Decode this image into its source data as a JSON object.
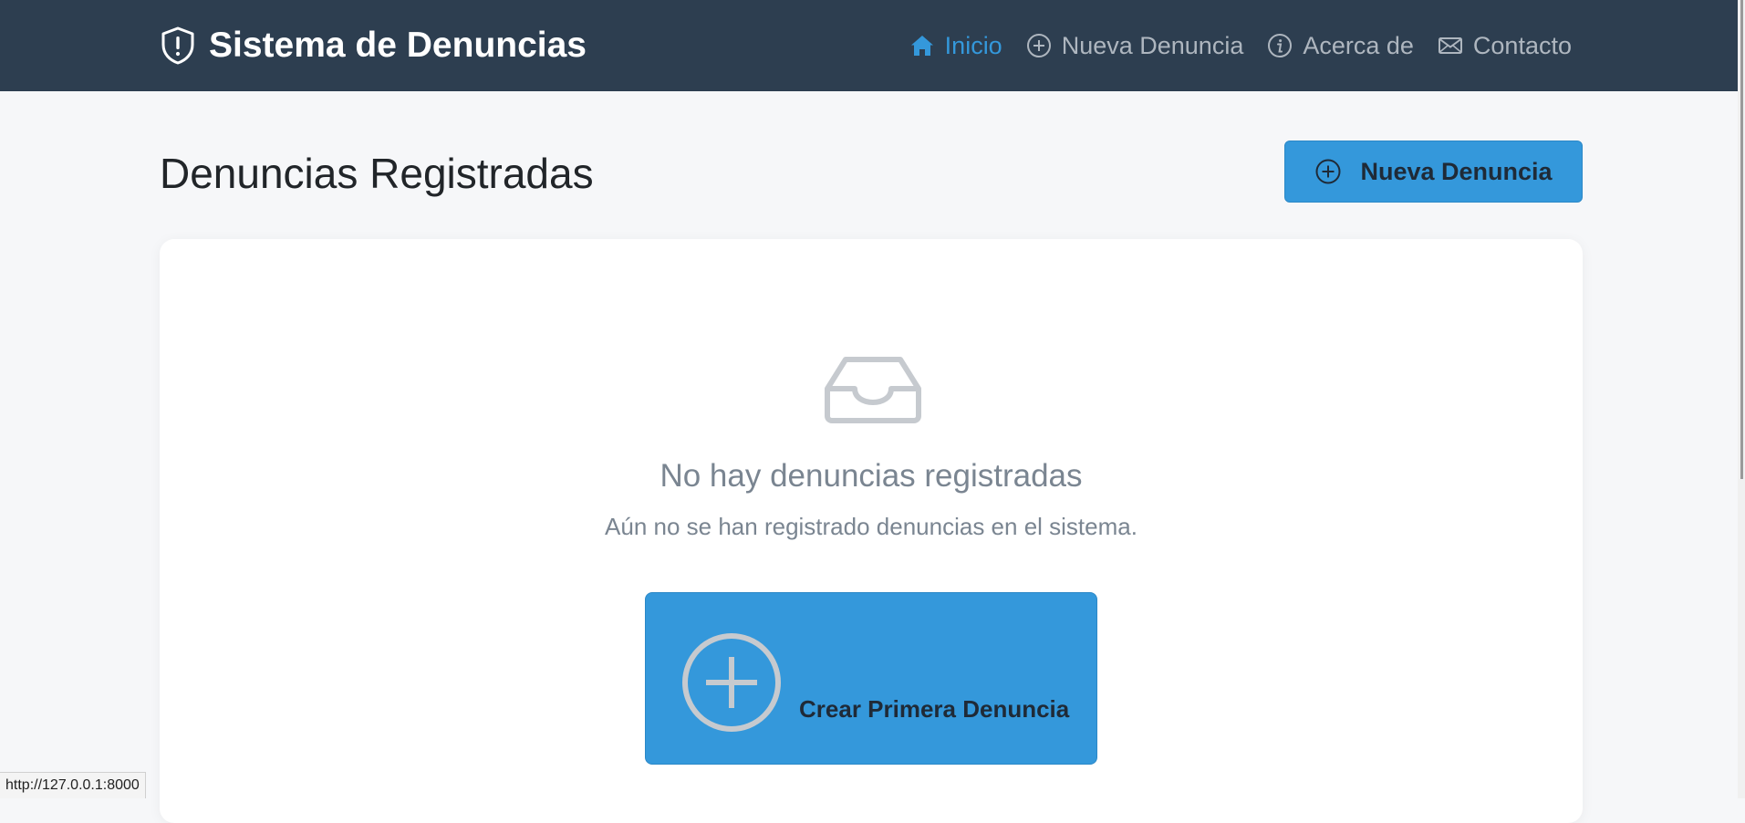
{
  "app": {
    "brand_title": "Sistema de Denuncias",
    "brand_icon": "shield-exclamation-icon"
  },
  "nav": {
    "items": [
      {
        "label": "Inicio",
        "icon": "house-icon",
        "active": true
      },
      {
        "label": "Nueva Denuncia",
        "icon": "plus-circle-icon",
        "active": false
      },
      {
        "label": "Acerca de",
        "icon": "info-circle-icon",
        "active": false
      },
      {
        "label": "Contacto",
        "icon": "envelope-icon",
        "active": false
      }
    ]
  },
  "header": {
    "title": "Denuncias Registradas",
    "new_button_label": "Nueva Denuncia"
  },
  "empty_state": {
    "icon": "inbox-icon",
    "title": "No hay denuncias registradas",
    "subtitle": "Aún no se han registrado denuncias en el sistema.",
    "cta_label": "Crear Primera Denuncia"
  },
  "status_bar": {
    "url": "http://127.0.0.1:8000"
  },
  "colors": {
    "navbar_bg": "#2d3e50",
    "accent": "#3498db",
    "page_bg": "#f6f7f9",
    "muted_text": "#7a8591"
  }
}
